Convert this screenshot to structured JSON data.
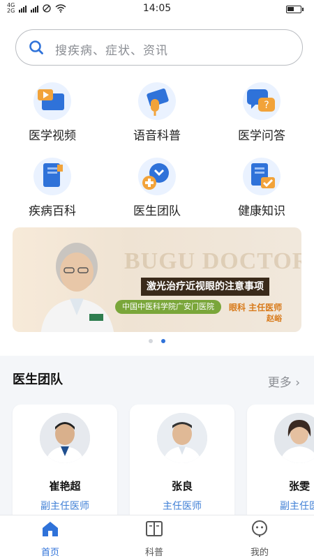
{
  "status_bar": {
    "network_top": "4G",
    "network_bottom": "2G",
    "time": "14:05",
    "battery_level": 0.5
  },
  "search": {
    "placeholder": "搜疾病、症状、资讯"
  },
  "quick_links": [
    {
      "label": "医学视频",
      "icon": "video-icon"
    },
    {
      "label": "语音科普",
      "icon": "microphone-icon"
    },
    {
      "label": "医学问答",
      "icon": "chat-question-icon"
    },
    {
      "label": "疾病百科",
      "icon": "book-icon"
    },
    {
      "label": "医生团队",
      "icon": "medical-team-icon"
    },
    {
      "label": "健康知识",
      "icon": "document-check-icon"
    }
  ],
  "banner": {
    "watermark": "BUGU DOCTOR",
    "title": "激光治疗近视眼的注意事项",
    "hospital": "中国中医科学院广安门医院",
    "department": "眼科  主任医师",
    "doctor": "赵峪",
    "current_slide": 2,
    "slide_count": 2
  },
  "doctor_team": {
    "title": "医生团队",
    "more": "更多 ›",
    "doctors": [
      {
        "name": "崔艳超",
        "title": "副主任医师"
      },
      {
        "name": "张良",
        "title": "主任医师"
      },
      {
        "name": "张雯",
        "title": "副主任医"
      }
    ]
  },
  "tabbar": {
    "tabs": [
      {
        "label": "首页",
        "icon": "home-icon",
        "active": true
      },
      {
        "label": "科普",
        "icon": "book-open-icon",
        "active": false
      },
      {
        "label": "我的",
        "icon": "profile-icon",
        "active": false
      }
    ]
  },
  "colors": {
    "accent": "#2f72d9",
    "title_blue": "#3f7fd6",
    "banner_orange": "#d87a1a",
    "banner_green": "#7aa63a"
  }
}
